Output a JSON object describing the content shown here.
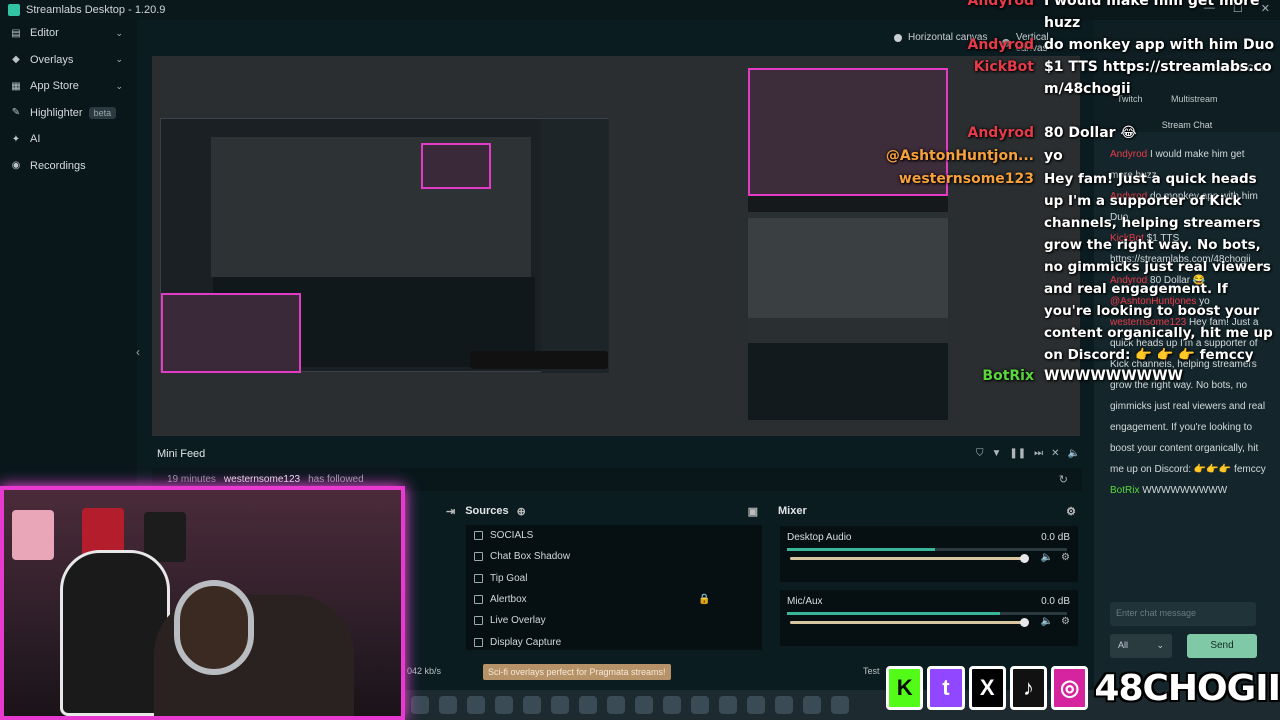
{
  "app": {
    "title": "Streamlabs Desktop - 1.20.9"
  },
  "sidebar": {
    "items": [
      {
        "label": "Editor",
        "icon": "editor-icon",
        "has_chevron": true
      },
      {
        "label": "Overlays",
        "icon": "overlays-icon",
        "has_chevron": true
      },
      {
        "label": "App Store",
        "icon": "app-store-icon",
        "has_chevron": true
      },
      {
        "label": "Highlighter",
        "icon": "highlighter-icon",
        "badge": "beta"
      },
      {
        "label": "AI",
        "icon": "ai-icon"
      },
      {
        "label": "Recordings",
        "icon": "recordings-icon"
      }
    ]
  },
  "studio": {
    "horizontal_canvas": "Horizontal canvas",
    "vertical_canvas": "Vertical canvas"
  },
  "mini_feed": {
    "title": "Mini Feed",
    "event": {
      "time": "19 minutes",
      "user": "westernsome123",
      "action": "has followed"
    }
  },
  "sources": {
    "title": "Sources",
    "items": [
      "SOCIALS",
      "Chat Box Shadow",
      "Tip Goal",
      "Alertbox",
      "Live Overlay",
      "Display Capture"
    ]
  },
  "mixer": {
    "title": "Mixer",
    "channels": [
      {
        "name": "Desktop Audio",
        "db": "0.0 dB",
        "level": 0.53,
        "volume": 1.0
      },
      {
        "name": "Mic/Aux",
        "db": "0.0 dB",
        "level": 0.76,
        "volume": 1.0
      }
    ]
  },
  "status": {
    "bitrate": "042 kb/s",
    "promo": "Sci-fi overlays perfect for Pragmata streams!",
    "test_label": "Test"
  },
  "chat_dock": {
    "refresh_label": "Refresh Chat",
    "tabs": [
      "Twitch",
      "Multistream"
    ],
    "stream_chat_label": "Stream Chat",
    "messages": [
      {
        "user": "Andyrod",
        "text": "I would make him get more huzz"
      },
      {
        "user": "Andyrod",
        "text": "do monkey app with him Duo"
      },
      {
        "user": "KickBot",
        "text": "$1 TTS https://streamlabs.com/48chogii"
      },
      {
        "user": "Andyrod",
        "text": "80 Dollar 😂"
      },
      {
        "user": "@AshtonHuntjones",
        "text": "yo"
      },
      {
        "user": "westernsome123",
        "text": "Hey fam! Just a quick heads up I'm a supporter of Kick channels, helping streamers grow the right way. No bots, no gimmicks just real viewers and real engagement. If you're looking to boost your content organically, hit me up on Discord: 👉👉👉 femccy"
      },
      {
        "user": "BotRix",
        "text": "WWWWWWWWW"
      }
    ],
    "input_placeholder": "Enter chat message",
    "select_value": "All",
    "send_label": "Send"
  },
  "overlay_chat": {
    "lines": [
      {
        "user": "Andyrod",
        "text": "I would make him get more huzz",
        "color": "#e63b48"
      },
      {
        "user": "Andyrod",
        "text": "do monkey app with him Duo",
        "color": "#e63b48"
      },
      {
        "user": "KickBot",
        "text": "$1 TTS https://streamlabs.com/48chogii",
        "color": "#e63b48"
      },
      {
        "user": "Andyrod",
        "text": "80 Dollar 😂",
        "color": "#e63b48"
      },
      {
        "user": "@AshtonHuntjon...",
        "text": "yo",
        "color": "#f7a13c"
      },
      {
        "user": "westernsome123",
        "text": "Hey fam! Just a quick heads up I'm a supporter of Kick channels, helping streamers grow the right way. No bots, no gimmicks just real viewers and real engagement. If you're looking to boost your content organically, hit me up on Discord: 👉 👉 👉 femccy",
        "color": "#f7a13c"
      },
      {
        "user": "BotRix",
        "text": "WWWWWWWWW",
        "color": "#59d73d"
      }
    ]
  },
  "socials": {
    "handle": "48CHOGII",
    "icons": [
      {
        "name": "kick-icon",
        "glyph": "K",
        "color": "#53fc18"
      },
      {
        "name": "twitch-icon",
        "glyph": "t",
        "color": "#9146ff"
      },
      {
        "name": "x-icon",
        "glyph": "X",
        "color": "#000000"
      },
      {
        "name": "tiktok-icon",
        "glyph": "♪",
        "color": "#111111"
      },
      {
        "name": "instagram-icon",
        "glyph": "◎",
        "color": "#d6249f"
      }
    ]
  },
  "colors": {
    "accent": "#31c3a2",
    "overlay_pink": "#e83ad0",
    "send_button": "#80c9a7"
  }
}
